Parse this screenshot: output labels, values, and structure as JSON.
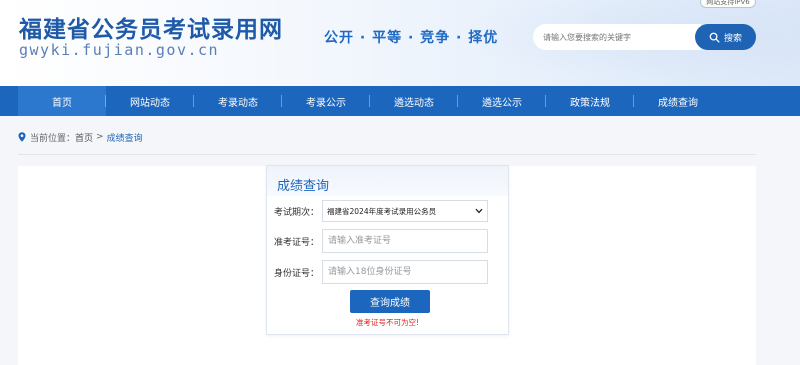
{
  "header": {
    "site_title": "福建省公务员考试录用网",
    "domain": "gwyki.fujian.gov.cn",
    "slogan": "公开 · 平等 · 竞争 · 择优",
    "ipv6_badge": "网站支持IPV6",
    "search": {
      "placeholder": "请输入您要搜索的关键字",
      "button_label": "搜索"
    }
  },
  "nav": {
    "items": [
      {
        "label": "首页",
        "active": true
      },
      {
        "label": "网站动态",
        "active": false
      },
      {
        "label": "考录动态",
        "active": false
      },
      {
        "label": "考录公示",
        "active": false
      },
      {
        "label": "遴选动态",
        "active": false
      },
      {
        "label": "遴选公示",
        "active": false
      },
      {
        "label": "政策法规",
        "active": false
      },
      {
        "label": "成绩查询",
        "active": false
      }
    ]
  },
  "breadcrumb": {
    "prefix": "当前位置：",
    "home": "首页",
    "separator": ">",
    "current": "成绩查询"
  },
  "form": {
    "title": "成绩查询",
    "exam_period": {
      "label": "考试期次：",
      "selected": "福建省2024年度考试录用公务员"
    },
    "ticket_no": {
      "label": "准考证号：",
      "placeholder": "请输入准考证号"
    },
    "id_no": {
      "label": "身份证号：",
      "placeholder": "请输入18位身份证号"
    },
    "submit_label": "查询成绩",
    "error_message": "准考证号不可为空!"
  },
  "colors": {
    "brand_blue": "#1c66bd",
    "error_red": "#e02020"
  }
}
